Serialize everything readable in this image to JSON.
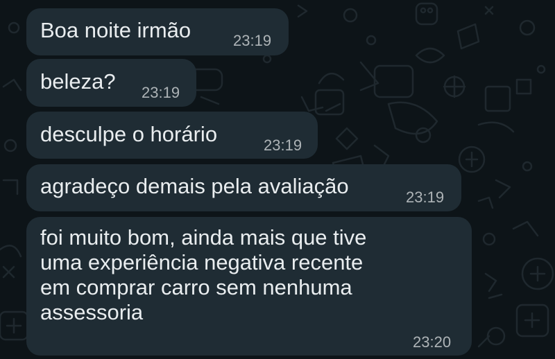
{
  "chat": {
    "messages": [
      {
        "text": "Boa noite irmão",
        "time": "23:19"
      },
      {
        "text": "beleza?",
        "time": "23:19"
      },
      {
        "text": "desculpe o horário",
        "time": "23:19"
      },
      {
        "text": "agradeço demais pela avaliação",
        "time": "23:19"
      },
      {
        "text": "foi muito bom, ainda mais que tive\numa experiência negativa recente\nem comprar carro sem nenhuma\nassessoria",
        "time": "23:20"
      }
    ]
  }
}
